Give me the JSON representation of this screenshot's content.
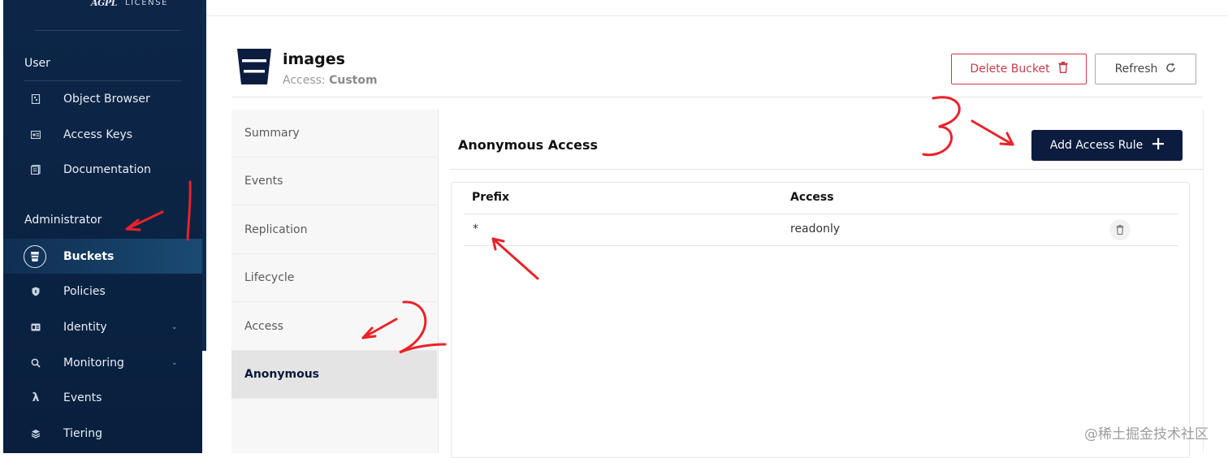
{
  "logo": {
    "mark": "AGPL",
    "text": "LICENSE"
  },
  "sidebar": {
    "user_section": "User",
    "user_items": [
      {
        "label": "Object Browser",
        "icon": "object-browser-icon"
      },
      {
        "label": "Access Keys",
        "icon": "access-keys-icon"
      },
      {
        "label": "Documentation",
        "icon": "documentation-icon"
      }
    ],
    "admin_section": "Administrator",
    "admin_items": [
      {
        "label": "Buckets",
        "icon": "bucket-icon",
        "active": true
      },
      {
        "label": "Policies",
        "icon": "shield-icon"
      },
      {
        "label": "Identity",
        "icon": "id-card-icon",
        "expandable": true
      },
      {
        "label": "Monitoring",
        "icon": "magnifier-icon",
        "expandable": true
      },
      {
        "label": "Events",
        "icon": "lambda-icon"
      },
      {
        "label": "Tiering",
        "icon": "layers-icon"
      }
    ]
  },
  "bucket": {
    "name": "images",
    "access_label": "Access:",
    "access_value": "Custom"
  },
  "header_buttons": {
    "delete": "Delete Bucket",
    "refresh": "Refresh"
  },
  "tabs": [
    "Summary",
    "Events",
    "Replication",
    "Lifecycle",
    "Access",
    "Anonymous"
  ],
  "selected_tab": "Anonymous",
  "panel": {
    "title": "Anonymous Access",
    "add_button": "Add Access Rule",
    "columns": [
      "Prefix",
      "Access"
    ],
    "rows": [
      {
        "prefix": "*",
        "access": "readonly"
      }
    ]
  },
  "annotations": {
    "mark_1": "1",
    "mark_2": "2",
    "mark_3": "3",
    "color": "#e8232a"
  },
  "watermark": "@稀土掘金技术社区",
  "colors": {
    "sidebar_bg": "#0b2343",
    "primary_button": "#0b1c3e",
    "danger": "#c83a4a"
  }
}
